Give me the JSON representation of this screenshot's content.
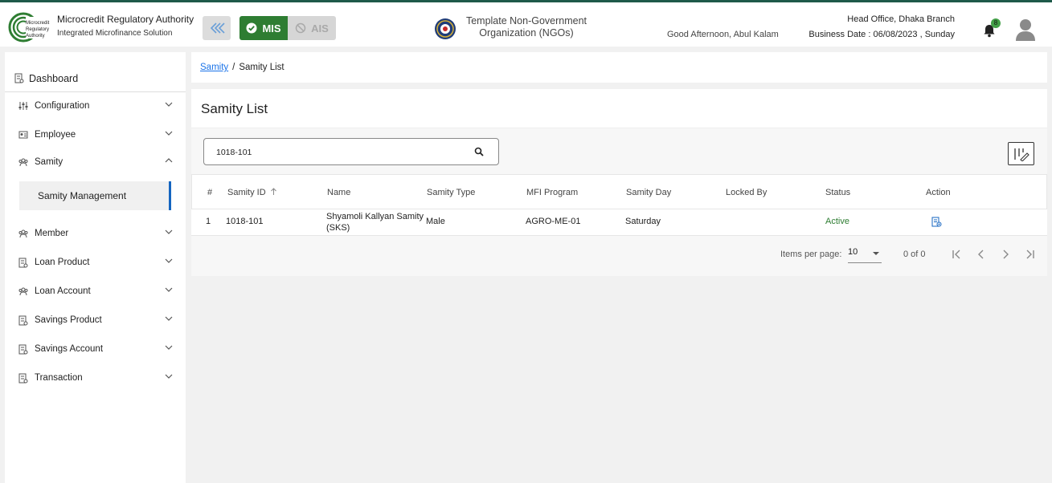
{
  "header": {
    "org_title": "Microcredit Regulatory Authority",
    "org_subtitle": "Integrated Microfinance Solution",
    "logo_text": [
      "Microcredit",
      "Regulatory",
      "Authority"
    ],
    "mis_label": "MIS",
    "ais_label": "AIS",
    "org_center_line1": "Template Non-Government",
    "org_center_line2": "Organization (NGOs)",
    "greeting": "Good Afternoon, Abul Kalam",
    "branch": "Head Office, Dhaka Branch",
    "business_date": "Business Date : 06/08/2023 , Sunday",
    "notification_count": "8",
    "colors": {
      "accent": "#2e7d32",
      "topline": "#1e5a4a"
    }
  },
  "sidebar": {
    "dashboard": "Dashboard",
    "items": [
      {
        "label": "Configuration",
        "icon": "sliders-icon",
        "expanded": false
      },
      {
        "label": "Employee",
        "icon": "id-card-icon",
        "expanded": false
      },
      {
        "label": "Samity",
        "icon": "group-icon",
        "expanded": true
      },
      {
        "label": "Member",
        "icon": "group-icon",
        "expanded": false
      },
      {
        "label": "Loan Product",
        "icon": "document-icon",
        "expanded": false
      },
      {
        "label": "Loan Account",
        "icon": "group-icon",
        "expanded": false
      },
      {
        "label": "Savings Product",
        "icon": "document-icon",
        "expanded": false
      },
      {
        "label": "Savings Account",
        "icon": "document-icon",
        "expanded": false
      },
      {
        "label": "Transaction",
        "icon": "document-icon",
        "expanded": false
      }
    ],
    "sub_item": "Samity Management"
  },
  "breadcrumb": {
    "link": "Samity",
    "separator": "/",
    "current": "Samity List"
  },
  "main": {
    "title": "Samity List",
    "search_value": "1018-101",
    "columns": [
      "#",
      "Samity ID",
      "Name",
      "Samity Type",
      "MFI Program",
      "Samity Day",
      "Locked By",
      "Status",
      "Action"
    ],
    "rows": [
      {
        "num": "1",
        "samity_id": "1018-101",
        "name_line1": "Shyamoli Kallyan Samity",
        "name_line2": "(SKS)",
        "type": "Male",
        "program": "AGRO-ME-01",
        "day": "Saturday",
        "locked_by": "",
        "status": "Active"
      }
    ],
    "pagination": {
      "items_per_page_label": "Items per page:",
      "items_per_page": "10",
      "range": "0 of 0"
    }
  }
}
